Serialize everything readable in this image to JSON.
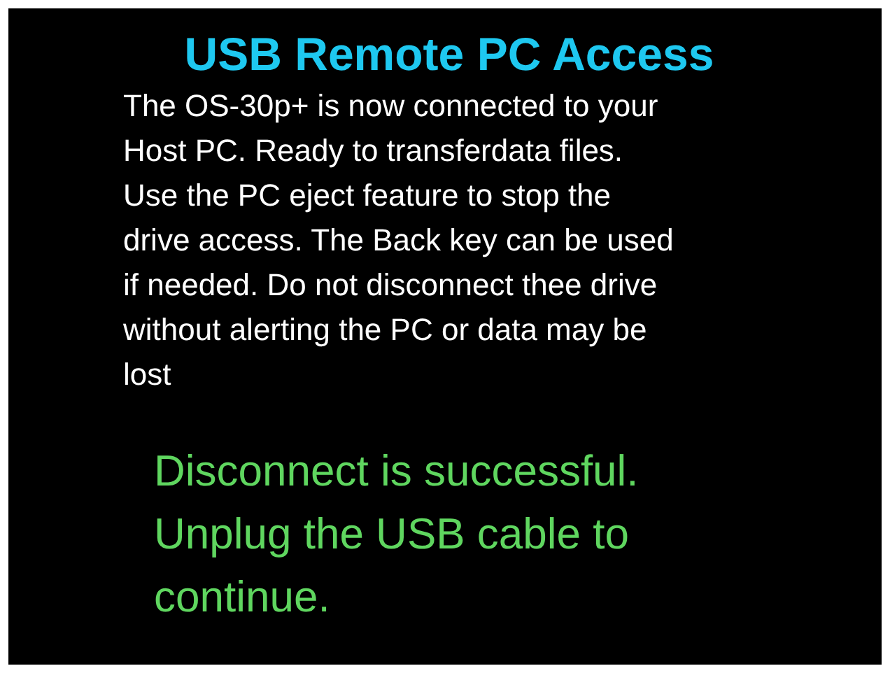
{
  "title": "USB Remote PC Access",
  "message": "The OS-30p+ is now connected to your\nHost PC. Ready to transferdata files.\nUse the PC eject feature to stop the\ndrive access. The Back key can be used\nif needed. Do not disconnect thee drive\nwithout alerting the PC or data may be\nlost",
  "status": "Disconnect is successful.\nUnplug the USB cable to\ncontinue."
}
